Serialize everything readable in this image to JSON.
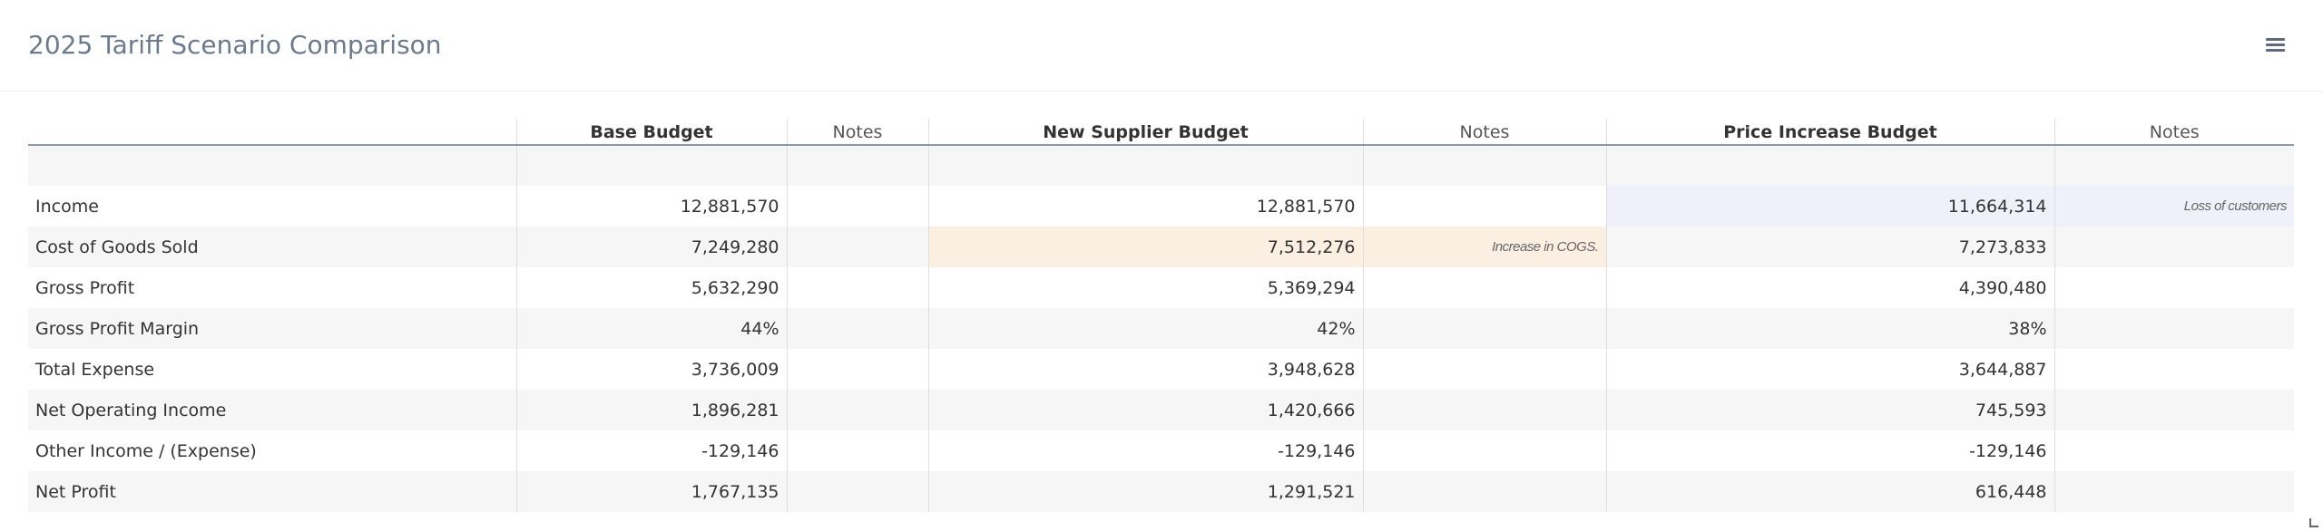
{
  "header": {
    "title": "2025 Tariff Scenario Comparison",
    "menu_icon": "hamburger-menu-icon"
  },
  "table": {
    "columns": {
      "base": "Base Budget",
      "base_notes": "Notes",
      "supplier": "New Supplier Budget",
      "supplier_notes": "Notes",
      "price": "Price Increase Budget",
      "price_notes": "Notes"
    },
    "rows": [
      {
        "label": "Income",
        "base": "12,881,570",
        "supplier": "12,881,570",
        "supplier_note": "",
        "price": "11,664,314",
        "price_note": "Loss of customers"
      },
      {
        "label": "Cost of Goods Sold",
        "base": "7,249,280",
        "supplier": "7,512,276",
        "supplier_note": "Increase in COGS.",
        "price": "7,273,833",
        "price_note": ""
      },
      {
        "label": "Gross Profit",
        "base": "5,632,290",
        "supplier": "5,369,294",
        "supplier_note": "",
        "price": "4,390,480",
        "price_note": ""
      },
      {
        "label": "Gross Profit Margin",
        "base": "44%",
        "supplier": "42%",
        "supplier_note": "",
        "price": "38%",
        "price_note": ""
      },
      {
        "label": "Total Expense",
        "base": "3,736,009",
        "supplier": "3,948,628",
        "supplier_note": "",
        "price": "3,644,887",
        "price_note": ""
      },
      {
        "label": "Net Operating Income",
        "base": "1,896,281",
        "supplier": "1,420,666",
        "supplier_note": "",
        "price": "745,593",
        "price_note": ""
      },
      {
        "label": "Other Income / (Expense)",
        "base": "-129,146",
        "supplier": "-129,146",
        "supplier_note": "",
        "price": "-129,146",
        "price_note": ""
      },
      {
        "label": "Net Profit",
        "base": "1,767,135",
        "supplier": "1,291,521",
        "supplier_note": "",
        "price": "616,448",
        "price_note": ""
      }
    ]
  },
  "colors": {
    "title": "#6b7a8c",
    "highlight_price": "#f0f0fa",
    "highlight_supplier": "#fbefe2",
    "header_rule": "#8c98a8"
  }
}
